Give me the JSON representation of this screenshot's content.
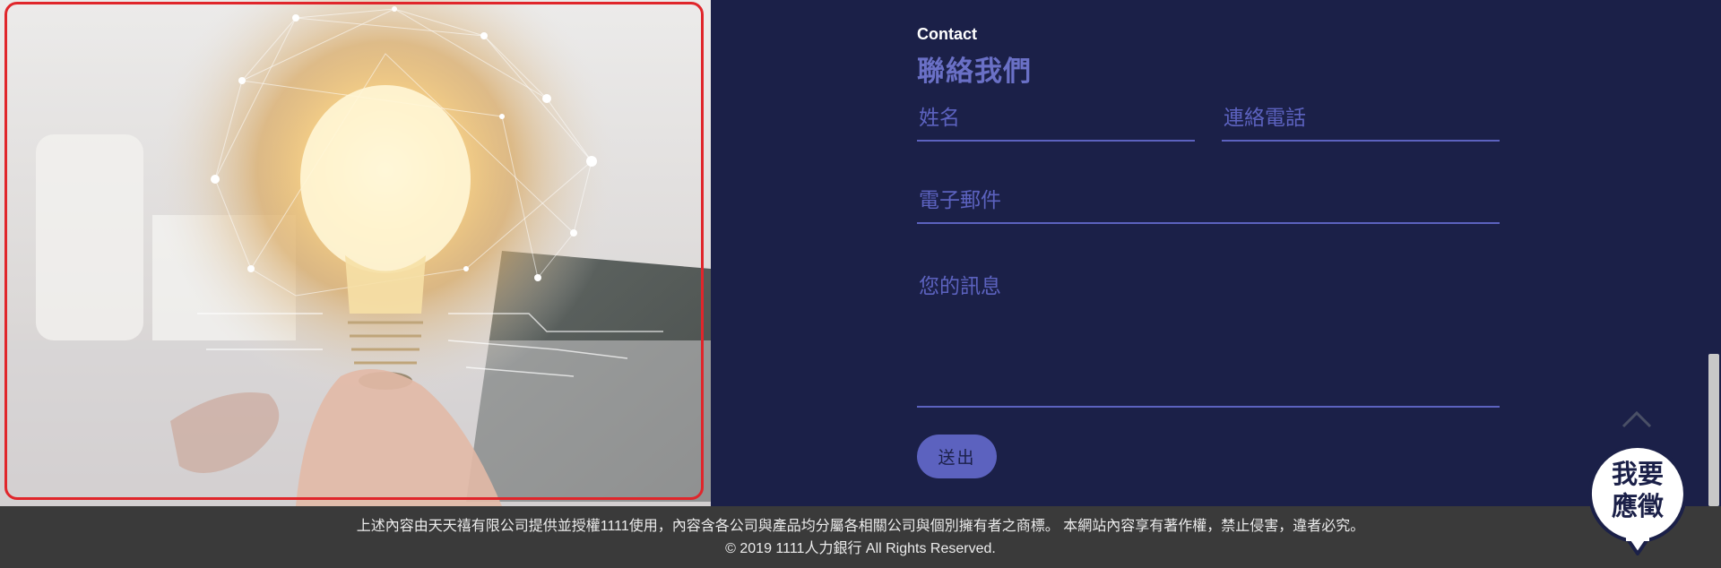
{
  "contact": {
    "eyebrow": "Contact",
    "heading": "聯絡我們",
    "name_placeholder": "姓名",
    "phone_placeholder": "連絡電話",
    "email_placeholder": "電子郵件",
    "message_placeholder": "您的訊息",
    "submit_label": "送出"
  },
  "apply_button": {
    "label_line1": "我要",
    "label_line2": "應徵"
  },
  "footer": {
    "notice": "上述內容由天天禧有限公司提供並授權1111使用，內容含各公司與產品均分屬各相關公司與個別擁有者之商標。 本網站內容享有著作權，禁止侵害，違者必究。",
    "copyright": "© 2019 1111人力銀行 All Rights Reserved."
  },
  "icons": {
    "back_to_top": "chevron-up-icon",
    "hero": "lightbulb-network-image"
  },
  "colors": {
    "panel_bg": "#1b2048",
    "accent": "#5c62bf",
    "footer_bg": "#3a3a3a",
    "frame": "#e0262b"
  }
}
